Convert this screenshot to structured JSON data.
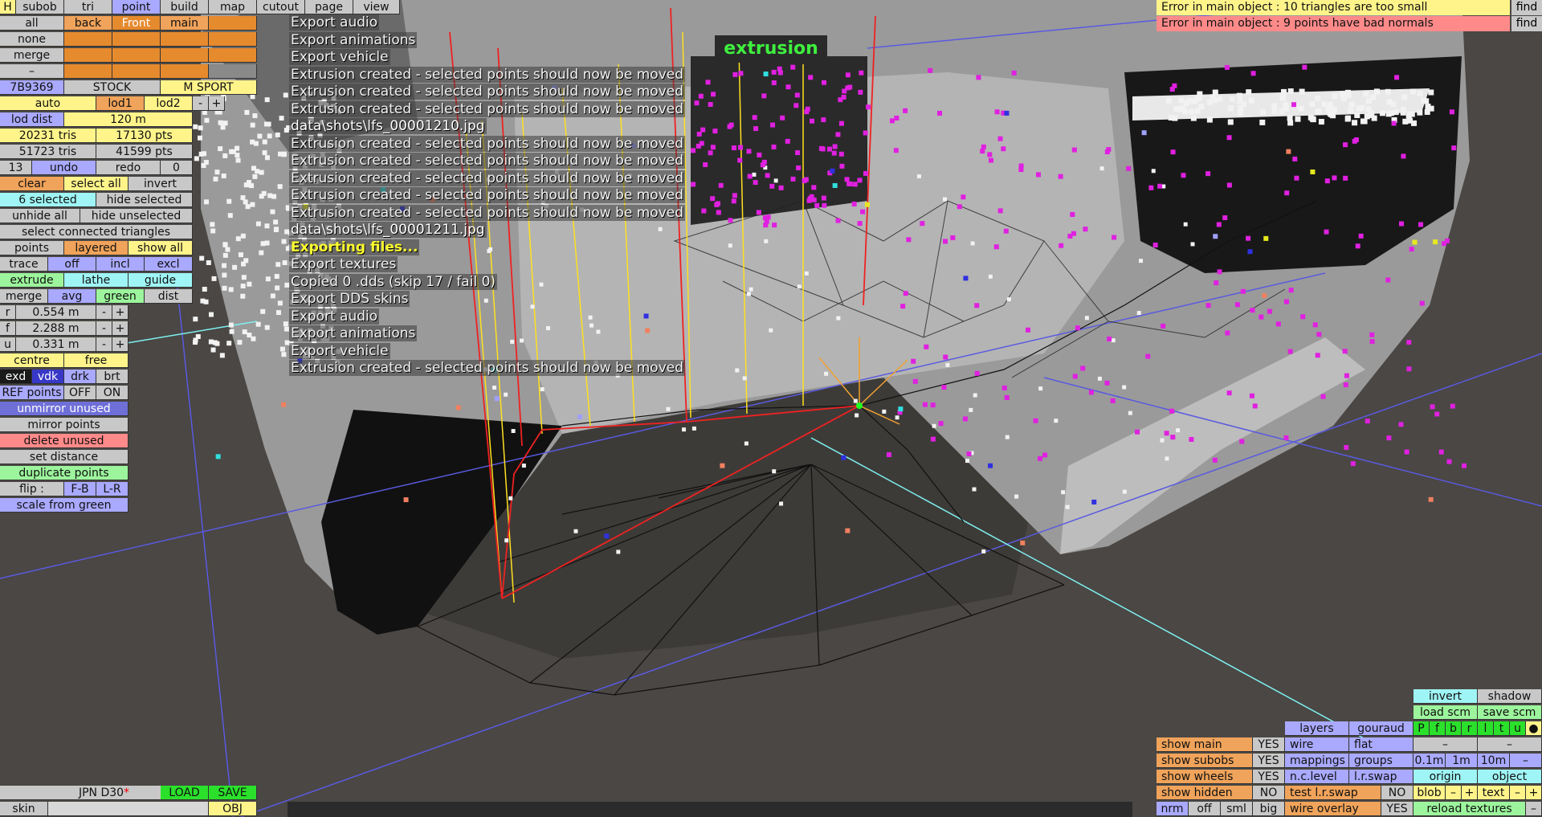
{
  "top_menu": {
    "h": "H",
    "subob": "subob",
    "tri": "tri",
    "point": "point",
    "build": "build",
    "map": "map",
    "cutout": "cutout",
    "page": "page",
    "view": "view"
  },
  "left": {
    "all": "all",
    "back": "back",
    "front": "Front",
    "main": "main",
    "none": "none",
    "merge": "merge",
    "dash": "–",
    "id": "7B9369",
    "stock": "STOCK",
    "msport": "M SPORT",
    "auto": "auto",
    "lod1": "lod1",
    "lod2": "lod2",
    "minus": "-",
    "plus": "+",
    "lod_dist": "lod dist",
    "lod_dist_val": "120 m",
    "tris1": "20231 tris",
    "pts1": "17130 pts",
    "tris2": "51723 tris",
    "pts2": "41599 pts",
    "undo_count": "13",
    "undo": "undo",
    "redo": "redo",
    "redo_count": "0",
    "clear": "clear",
    "select_all": "select all",
    "invert": "invert",
    "selected": "6 selected",
    "hide_selected": "hide selected",
    "unhide_all": "unhide all",
    "hide_unselected": "hide unselected",
    "select_connected": "select connected triangles",
    "points": "points",
    "layered": "layered",
    "show_all": "show all",
    "trace": "trace",
    "off": "off",
    "incl": "incl",
    "excl": "excl",
    "extrude": "extrude",
    "lathe": "lathe",
    "guide": "guide",
    "merge2": "merge",
    "avg": "avg",
    "green": "green",
    "dist": "dist",
    "r": "r",
    "r_val": "0.554 m",
    "f": "f",
    "f_val": "2.288 m",
    "u": "u",
    "u_val": "0.331 m",
    "centre": "centre",
    "free": "free",
    "exd": "exd",
    "vdk": "vdk",
    "drk": "drk",
    "brt": "brt",
    "ref_points": "REF points",
    "ref_off": "OFF",
    "ref_on": "ON",
    "unmirror_unused": "unmirror unused",
    "mirror_points": "mirror points",
    "delete_unused": "delete unused",
    "set_distance": "set distance",
    "duplicate_points": "duplicate points",
    "flip": "flip :",
    "fb": "F-B",
    "lr": "L-R",
    "scale_from_green": "scale from green"
  },
  "bottom_left": {
    "name": "JPN D30",
    "asterisk": "*",
    "load": "LOAD",
    "save": "SAVE",
    "skin": "skin",
    "obj": "OBJ"
  },
  "log_lines": [
    {
      "text": "Export audio",
      "kind": "n"
    },
    {
      "text": "Export animations",
      "kind": "n"
    },
    {
      "text": "Export vehicle",
      "kind": "n"
    },
    {
      "text": "Extrusion created - selected points should now be moved",
      "kind": "n"
    },
    {
      "text": "Extrusion created - selected points should now be moved",
      "kind": "n"
    },
    {
      "text": "Extrusion created - selected points should now be moved",
      "kind": "n"
    },
    {
      "text": "data\\shots\\lfs_00001210.jpg",
      "kind": "w"
    },
    {
      "text": "Extrusion created - selected points should now be moved",
      "kind": "n"
    },
    {
      "text": "Extrusion created - selected points should now be moved",
      "kind": "n"
    },
    {
      "text": "Extrusion created - selected points should now be moved",
      "kind": "n"
    },
    {
      "text": "Extrusion created - selected points should now be moved",
      "kind": "n"
    },
    {
      "text": "Extrusion created - selected points should now be moved",
      "kind": "n"
    },
    {
      "text": "data\\shots\\lfs_00001211.jpg",
      "kind": "w"
    },
    {
      "text": "Exporting files...",
      "kind": "y"
    },
    {
      "text": "Export textures",
      "kind": "n"
    },
    {
      "text": "Copied 0 .dds (skip 17 / fail 0)",
      "kind": "n"
    },
    {
      "text": "Export DDS skins",
      "kind": "n"
    },
    {
      "text": "Export audio",
      "kind": "n"
    },
    {
      "text": "Export animations",
      "kind": "n"
    },
    {
      "text": "Export vehicle",
      "kind": "n"
    },
    {
      "text": "Extrusion created - selected points should now be moved",
      "kind": "n"
    }
  ],
  "mode_label": "extrusion",
  "errors": {
    "e1": "Error in main object : 10 triangles are too small",
    "e2": "Error in main object : 9 points have bad normals",
    "find": "find"
  },
  "right": {
    "invert": "invert",
    "shadow": "shadow",
    "load_scm": "load scm",
    "save_scm": "save scm",
    "layers": "layers",
    "gouraud": "gouraud",
    "p": "P",
    "f": "f",
    "b": "b",
    "r": "r",
    "l": "l",
    "t": "t",
    "u": "u",
    "dot": "●",
    "show_main": "show main",
    "show_main_v": "YES",
    "wire": "wire",
    "flat": "flat",
    "dash1": "–",
    "dash2": "–",
    "show_subobs": "show subobs",
    "show_subobs_v": "YES",
    "mappings": "mappings",
    "groups": "groups",
    "d01": "0.1m",
    "d1": "1m",
    "d10": "10m",
    "dminus": "–",
    "show_wheels": "show wheels",
    "show_wheels_v": "YES",
    "nclevel": "n.c.level",
    "lrswap": "l.r.swap",
    "origin": "origin",
    "object": "object",
    "show_hidden": "show hidden",
    "show_hidden_v": "NO",
    "test_lrswap": "test l.r.swap",
    "test_lrswap_v": "NO",
    "blob": "blob",
    "bminus": "–",
    "bplus": "+",
    "text": "text",
    "tminus": "–",
    "tplus": "+",
    "nrm": "nrm",
    "off": "off",
    "sml": "sml",
    "big": "big",
    "wire_overlay": "wire overlay",
    "wire_overlay_v": "YES",
    "reload_textures": "reload textures"
  }
}
